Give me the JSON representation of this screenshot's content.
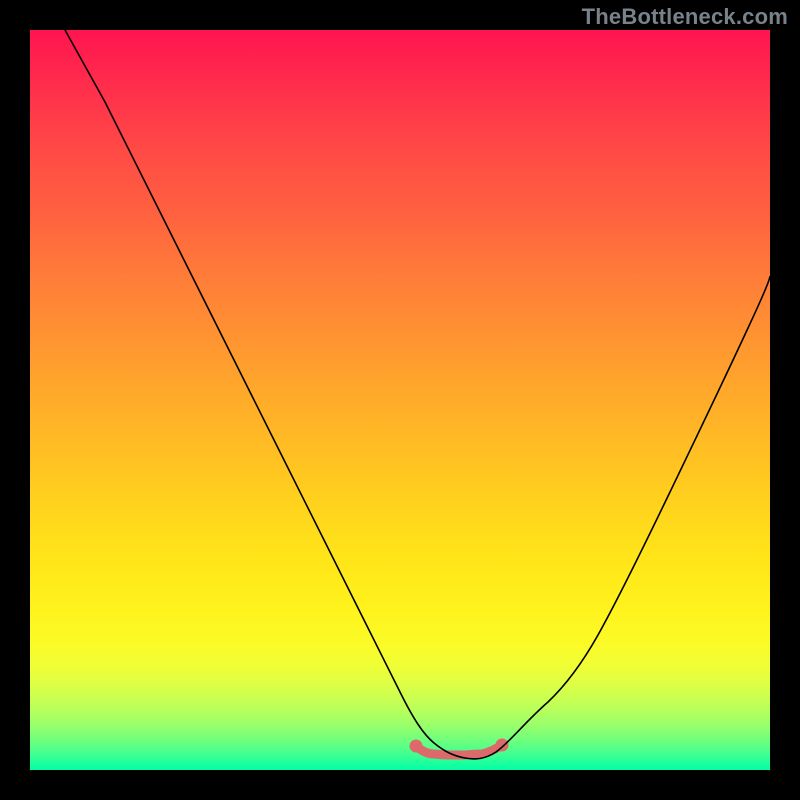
{
  "watermark": "TheBottleneck.com",
  "chart_data": {
    "type": "line",
    "title": "",
    "xlabel": "",
    "ylabel": "",
    "xlim": [
      0,
      100
    ],
    "ylim": [
      0,
      100
    ],
    "grid": false,
    "legend": false,
    "series": [
      {
        "name": "bottleneck-curve",
        "x": [
          5,
          10,
          15,
          20,
          25,
          30,
          35,
          40,
          45,
          50,
          53,
          56,
          58,
          60,
          65,
          70,
          75,
          80,
          85,
          90,
          95,
          100
        ],
        "y": [
          100,
          90,
          80,
          70,
          60,
          50,
          40,
          30,
          20,
          10,
          5,
          2,
          1,
          1,
          3,
          8,
          14,
          21,
          29,
          37,
          46,
          55
        ],
        "color": "#000000"
      }
    ],
    "annotations": [
      {
        "name": "optimal-zone-marker",
        "x_start": 52,
        "x_end": 64,
        "y": 3,
        "color": "#dd6a6a"
      }
    ],
    "background_gradient": {
      "direction": "vertical",
      "stops": [
        {
          "pos": 0.0,
          "color": "#ff1450"
        },
        {
          "pos": 0.5,
          "color": "#ffa62b"
        },
        {
          "pos": 0.8,
          "color": "#fff21c"
        },
        {
          "pos": 1.0,
          "color": "#00ffa6"
        }
      ]
    }
  }
}
